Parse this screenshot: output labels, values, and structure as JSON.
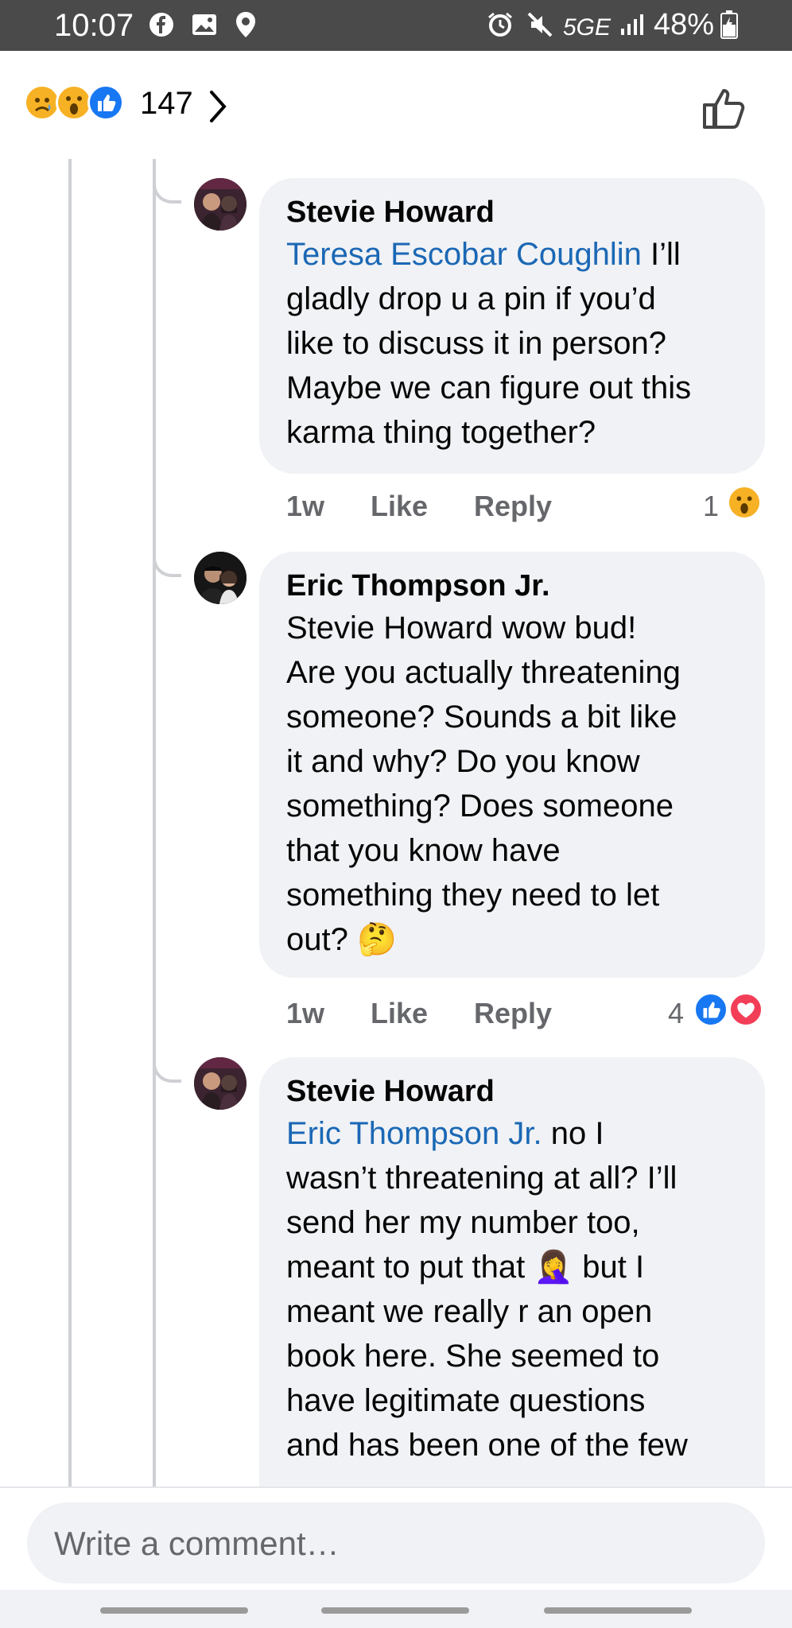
{
  "status_bar": {
    "time": "10:07",
    "network": "5GE",
    "battery": "48%",
    "icons": [
      "facebook-icon",
      "gallery-icon",
      "location-icon",
      "alarm-icon",
      "mute-icon",
      "signal-icon",
      "battery-icon"
    ]
  },
  "reactions_header": {
    "icons": [
      "sad-reaction-icon",
      "wow-reaction-icon",
      "like-reaction-icon"
    ],
    "count": "147"
  },
  "comments": [
    {
      "author": "Stevie Howard",
      "mention": "Teresa Escobar Coughlin",
      "lines": [
        " I’ll",
        "gladly drop u a pin if you’d",
        "like to discuss it in person?",
        "Maybe we can figure out this",
        "karma thing together?"
      ],
      "age": "1w",
      "like_label": "Like",
      "reply_label": "Reply",
      "reaction_count": "1",
      "reactions": [
        "wow-reaction-icon"
      ]
    },
    {
      "author": "Eric Thompson Jr.",
      "mention": "",
      "lines": [
        "Stevie Howard wow bud!",
        "Are you actually threatening",
        "someone?  Sounds a bit like",
        "it and why?  Do you know",
        "something?  Does someone",
        "that you know have",
        "something they need to let",
        "out?  🤔"
      ],
      "age": "1w",
      "like_label": "Like",
      "reply_label": "Reply",
      "reaction_count": "4",
      "reactions": [
        "like-reaction-icon",
        "love-reaction-icon"
      ]
    },
    {
      "author": "Stevie Howard",
      "mention": "Eric Thompson Jr.",
      "lines": [
        " no I",
        "wasn’t threatening at all? I’ll",
        "send her my number too,",
        "meant to put that 🤦‍♀️ but I",
        "meant we really r an open",
        "book here. She seemed to",
        "have legitimate questions",
        "and has been one of the few"
      ]
    }
  ],
  "composer": {
    "placeholder": "Write a comment…"
  },
  "colors": {
    "status_bar": "#4a4a4a",
    "bubble": "#f0f2f5",
    "mention": "#1b68b5",
    "meta_text": "#65676b",
    "like_blue": "#1877f2",
    "love_red": "#f33e58",
    "reaction_yellow": "#f7b125"
  }
}
